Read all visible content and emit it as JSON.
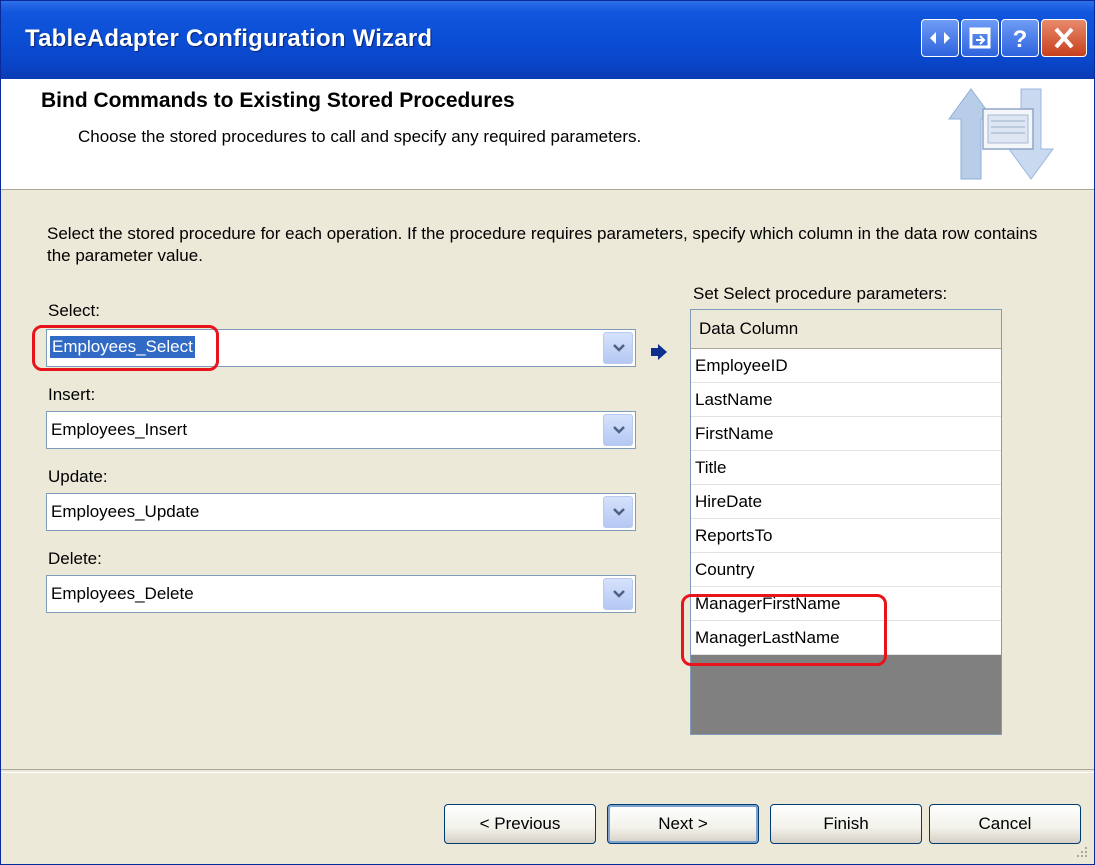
{
  "window": {
    "title": "TableAdapter Configuration Wizard"
  },
  "header": {
    "title": "Bind Commands to Existing Stored Procedures",
    "subtitle": "Choose the stored procedures to call and specify any required parameters."
  },
  "instructions": "Select the stored procedure for each operation. If the procedure requires parameters, specify which column in the data row contains the parameter value.",
  "fields": {
    "select": {
      "label": "Select:",
      "value": "Employees_Select"
    },
    "insert": {
      "label": "Insert:",
      "value": "Employees_Insert"
    },
    "update": {
      "label": "Update:",
      "value": "Employees_Update"
    },
    "delete": {
      "label": "Delete:",
      "value": "Employees_Delete"
    }
  },
  "parameters": {
    "label": "Set Select procedure parameters:",
    "header": "Data Column",
    "rows": [
      "EmployeeID",
      "LastName",
      "FirstName",
      "Title",
      "HireDate",
      "ReportsTo",
      "Country",
      "ManagerFirstName",
      "ManagerLastName"
    ]
  },
  "buttons": {
    "previous": "< Previous",
    "next": "Next >",
    "finish": "Finish",
    "cancel": "Cancel"
  },
  "icons": {
    "titlebar": [
      "back-forward-icon",
      "restore-icon",
      "help-icon",
      "close-icon"
    ],
    "header": "wizard-arrows-icon",
    "connector": "arrow-right-icon"
  }
}
